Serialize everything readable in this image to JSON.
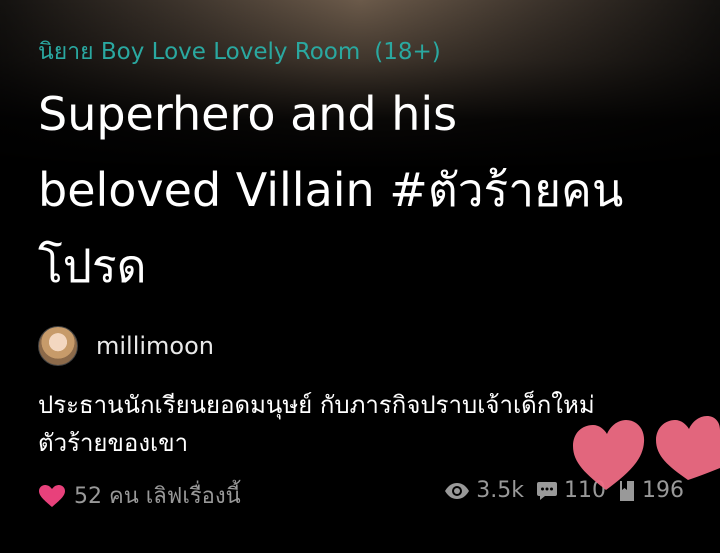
{
  "story": {
    "category": "นิยาย Boy Love Lovely Room",
    "rating": "(18+)",
    "title_lines": [
      "Superhero and his",
      "beloved Villain #ตัวร้ายคน",
      "โปรด"
    ],
    "author": "millimoon",
    "synopsis_lines": [
      "ประธานนักเรียนยอดมนุษย์ กับภารกิจปราบเจ้าเด็กใหม่",
      "ตัวร้ายของเขา"
    ]
  },
  "stats": {
    "likes_text": "52 คน เลิฟเรื่องนี้",
    "views": "3.5k",
    "comments": "110",
    "bookmarks": "196"
  },
  "icons": {
    "heart": "heart-icon",
    "views": "eye-icon",
    "comments": "comment-icon",
    "bookmarks": "bookmark-icon"
  },
  "colors": {
    "category": "#2aa8a0",
    "heart": "#e8417b",
    "muted": "#999999",
    "decor_heart": "#ee6c84"
  }
}
